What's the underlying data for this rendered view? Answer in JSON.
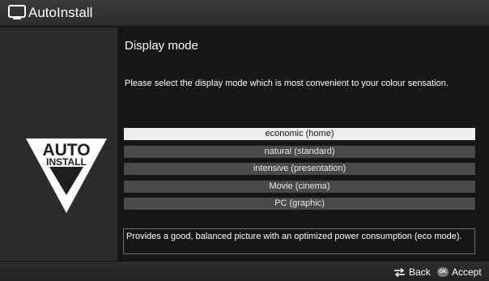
{
  "window": {
    "title": "AutoInstall",
    "icon": "tv-icon"
  },
  "logo": {
    "line1": "AUTO",
    "line2": "INSTALL",
    "icon": "auto-install-logo"
  },
  "main": {
    "heading": "Display mode",
    "instruction": "Please select the display mode which is most convenient to your colour sensation.",
    "options": [
      {
        "label": "economic (home)",
        "selected": true
      },
      {
        "label": "natural (standard)",
        "selected": false
      },
      {
        "label": "intensive (presentation)",
        "selected": false
      },
      {
        "label": "Movie (cinema)",
        "selected": false
      },
      {
        "label": "PC (graphic)",
        "selected": false
      }
    ],
    "description": "Provides a good, balanced picture with an optimized power consumption (eco mode)."
  },
  "footer": {
    "back_label": "Back",
    "back_icon": "swap-arrows-icon",
    "ok_icon_text": "OK",
    "accept_label": "Accept"
  },
  "colors": {
    "selected_bg": "#eeeeee",
    "option_bg": "#4a4a4a",
    "content_bg": "#161616",
    "panel_bg": "#2c2c2c"
  }
}
